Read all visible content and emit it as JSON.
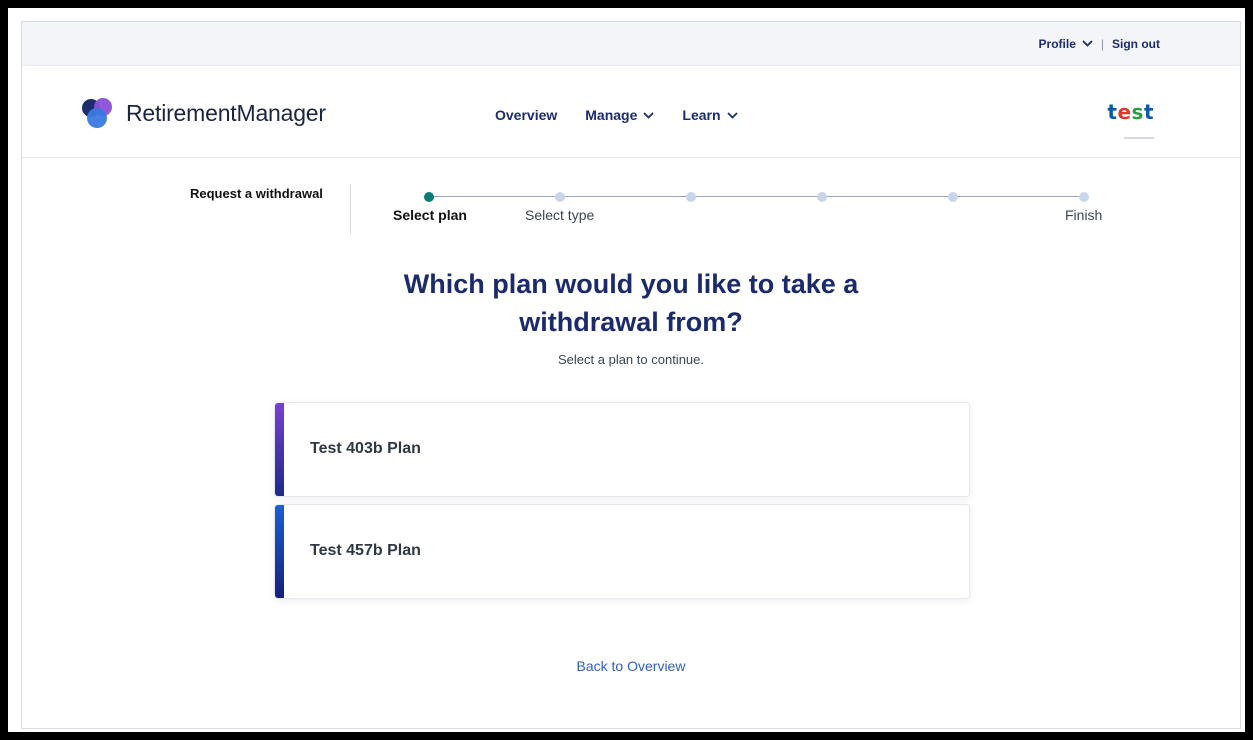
{
  "utility": {
    "profile_label": "Profile",
    "signout_label": "Sign out"
  },
  "header": {
    "logo_text": "RetirementManager",
    "nav": [
      {
        "label": "Overview"
      },
      {
        "label": "Manage"
      },
      {
        "label": "Learn"
      }
    ],
    "brand": {
      "t1": "t",
      "e": "e",
      "s": "s",
      "t2": "t"
    }
  },
  "stepper": {
    "title": "Request a withdrawal",
    "steps": [
      {
        "label": "Select plan",
        "active": true
      },
      {
        "label": "Select type",
        "active": false
      },
      {
        "label": "",
        "active": false
      },
      {
        "label": "",
        "active": false
      },
      {
        "label": "",
        "active": false
      },
      {
        "label": "Finish",
        "active": false
      }
    ]
  },
  "main": {
    "question_line1": "Which plan would you like to take a",
    "question_line2": "withdrawal from?",
    "subtitle": "Select a plan to continue.",
    "plans": [
      {
        "name": "Test 403b Plan",
        "accent_top": "#7a3fd1",
        "accent_bottom": "#1c2a8a"
      },
      {
        "name": "Test 457b Plan",
        "accent_top": "#1a5fd6",
        "accent_bottom": "#14207a"
      }
    ],
    "back_link": "Back to Overview"
  }
}
